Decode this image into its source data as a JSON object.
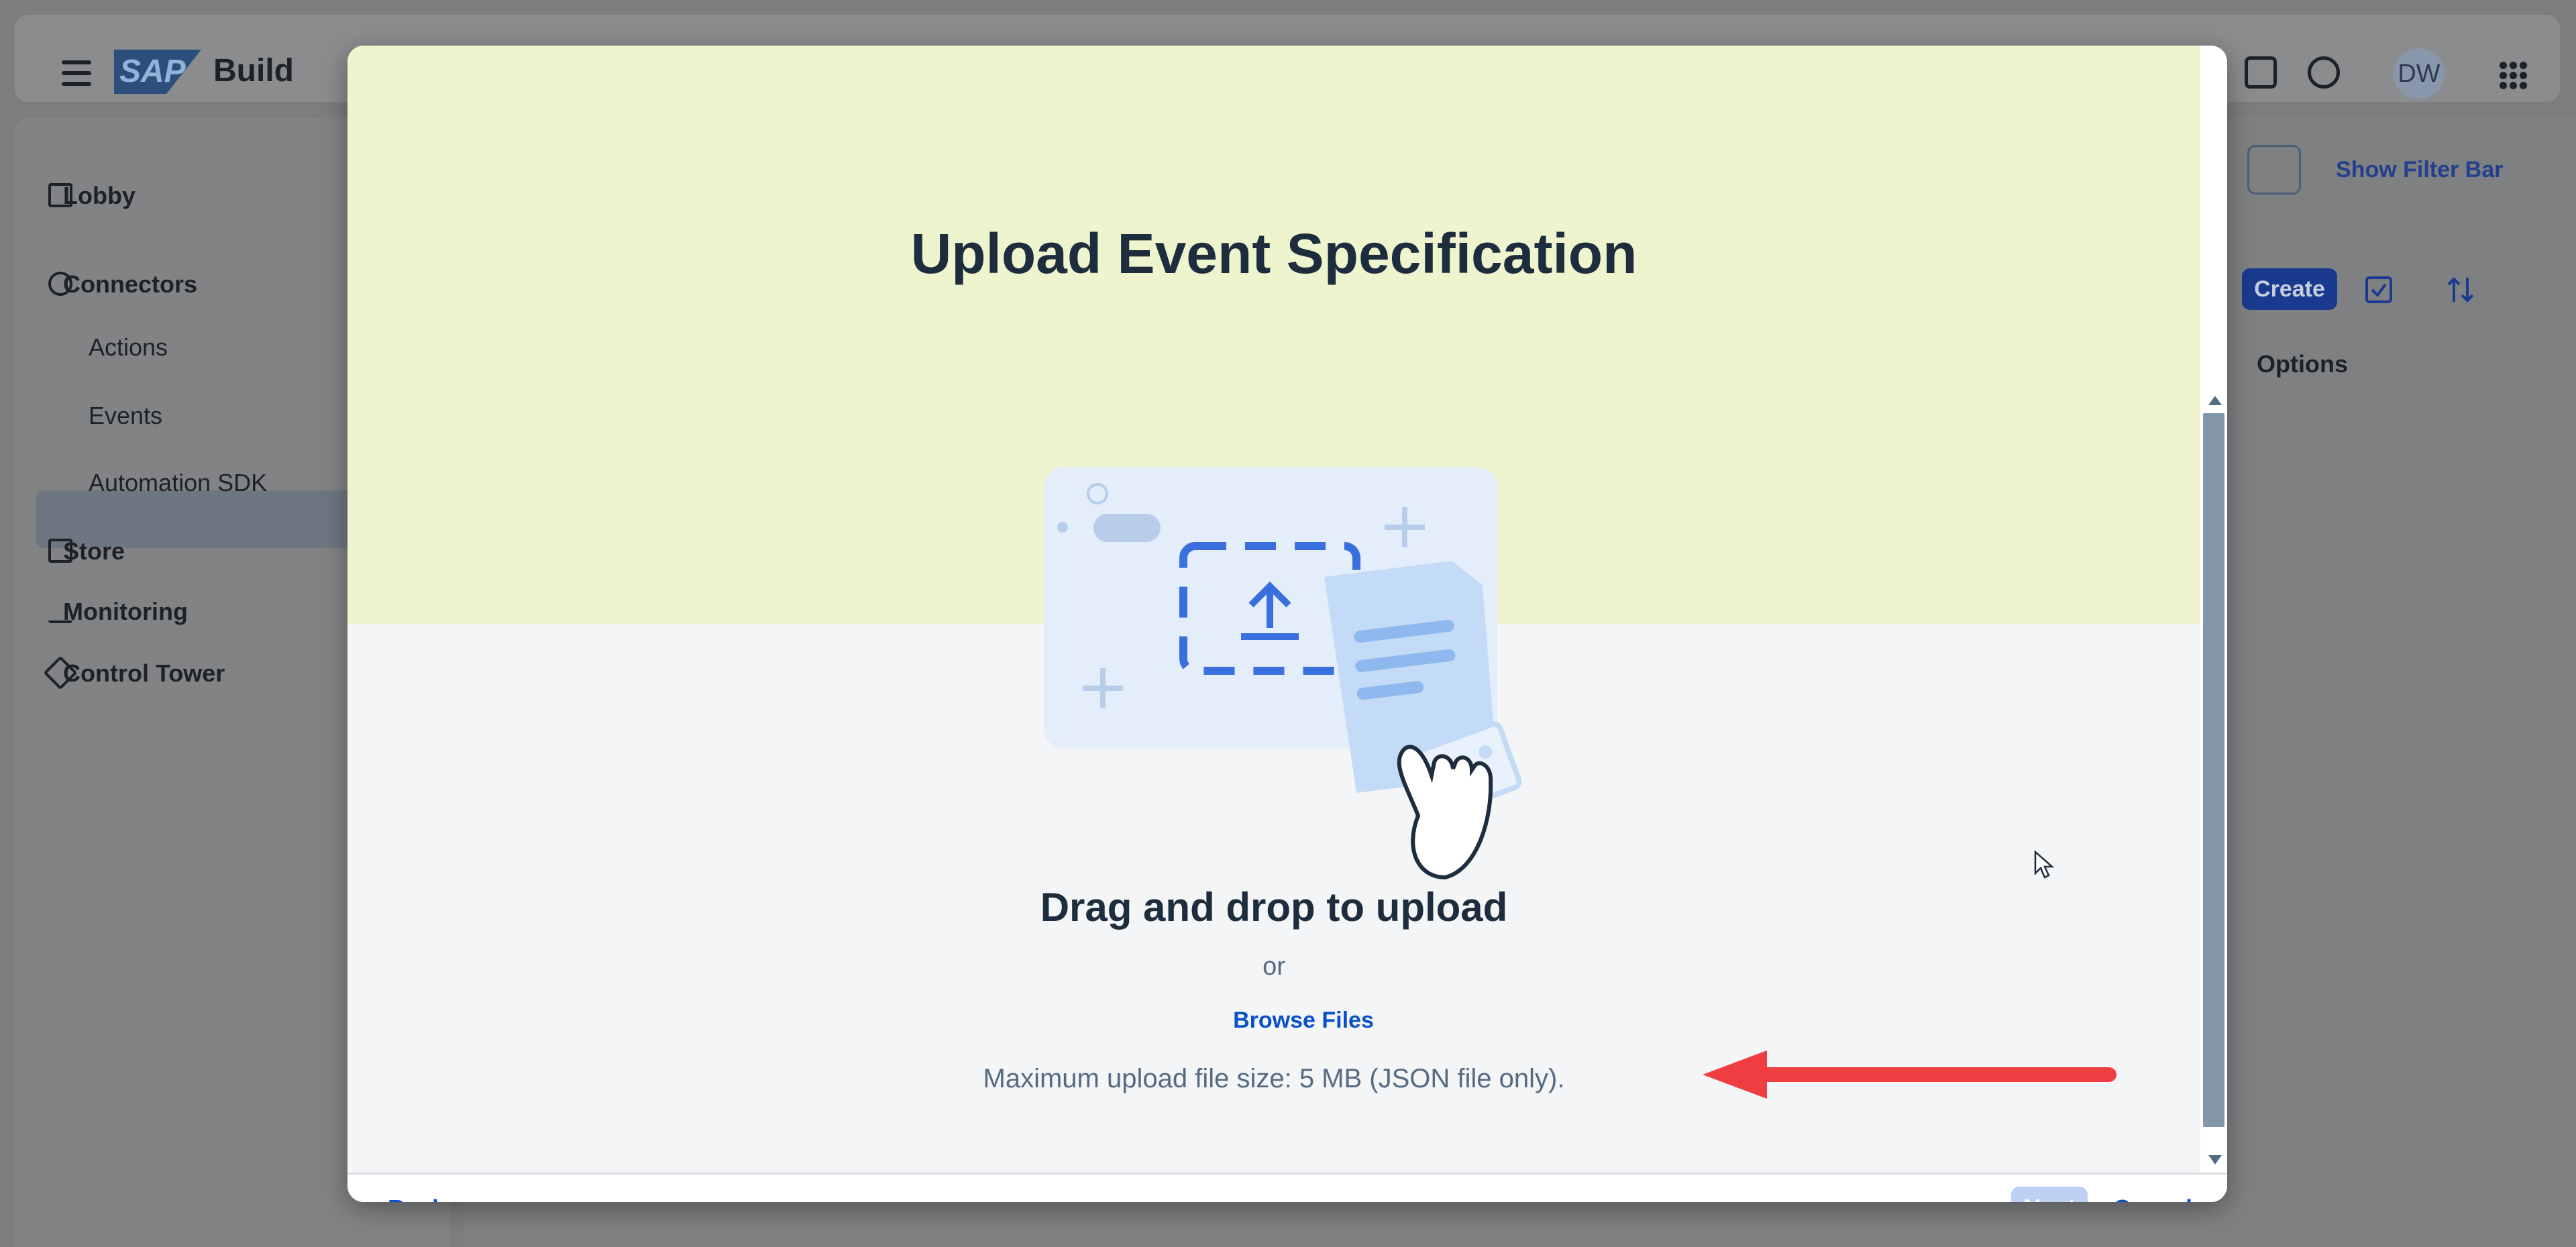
{
  "shell": {
    "brand": "Build",
    "logo_text": "SAP",
    "avatar_initials": "DW"
  },
  "sidebar": {
    "items": [
      {
        "label": "Lobby",
        "icon": "home-icon"
      },
      {
        "label": "Connectors",
        "icon": "connector-icon"
      },
      {
        "label": "Actions"
      },
      {
        "label": "Events",
        "selected": true
      },
      {
        "label": "Automation SDK"
      },
      {
        "label": "Store",
        "icon": "store-icon"
      },
      {
        "label": "Monitoring",
        "icon": "chart-line-icon"
      },
      {
        "label": "Control Tower",
        "icon": "wrench-icon"
      }
    ]
  },
  "page": {
    "show_filter_bar": "Show Filter Bar",
    "create_label": "Create",
    "options_header": "Options"
  },
  "dialog": {
    "title": "Upload Event Specification",
    "drag_text": "Drag and drop to upload",
    "or_text": "or",
    "browse_label": "Browse Files",
    "max_size_text": "Maximum upload file size: 5 MB (JSON file only).",
    "back_label": "Back",
    "next_label": "Next",
    "cancel_label": "Cancel"
  },
  "colors": {
    "accent": "#0a50c8",
    "hero_top": "#eef5ce",
    "annotation_arrow": "#ef3e42"
  }
}
